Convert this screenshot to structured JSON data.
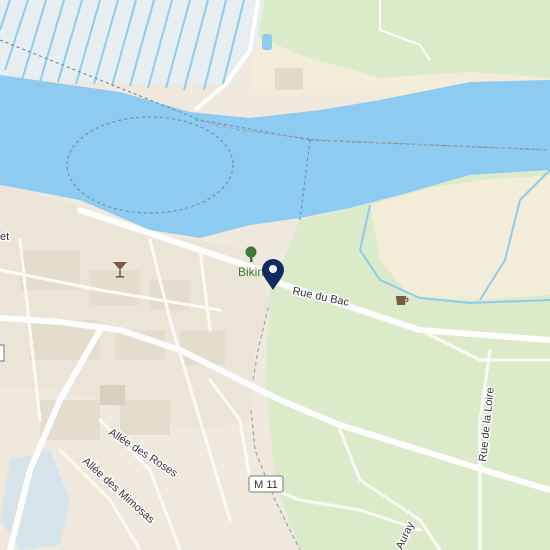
{
  "map": {
    "colors": {
      "water": "#8ecbf1",
      "land": "#efe9dd",
      "green": "#dbebc9",
      "road_major": "#ffffff",
      "road_minor": "#fbfaf5",
      "building": "#e4dccc",
      "poi_green": "#3c7a2f",
      "marker": "#102a63"
    },
    "labels": {
      "street_rue_du_bac": "Rue du Bac",
      "street_rue_de_la_loire": "Rue de la Loire",
      "street_allee_des_roses": "Allée des Roses",
      "street_allee_des_mimosas": "Allée des Mimosas",
      "street_auray": "Auray",
      "road_shield": "M 11",
      "poi_biking": "Bikin",
      "edge_left": "et"
    },
    "icons": {
      "tree": "tree-icon",
      "cocktail": "cocktail-bar-icon",
      "cafe": "cafe-icon",
      "pin": "location-pin-icon"
    }
  }
}
